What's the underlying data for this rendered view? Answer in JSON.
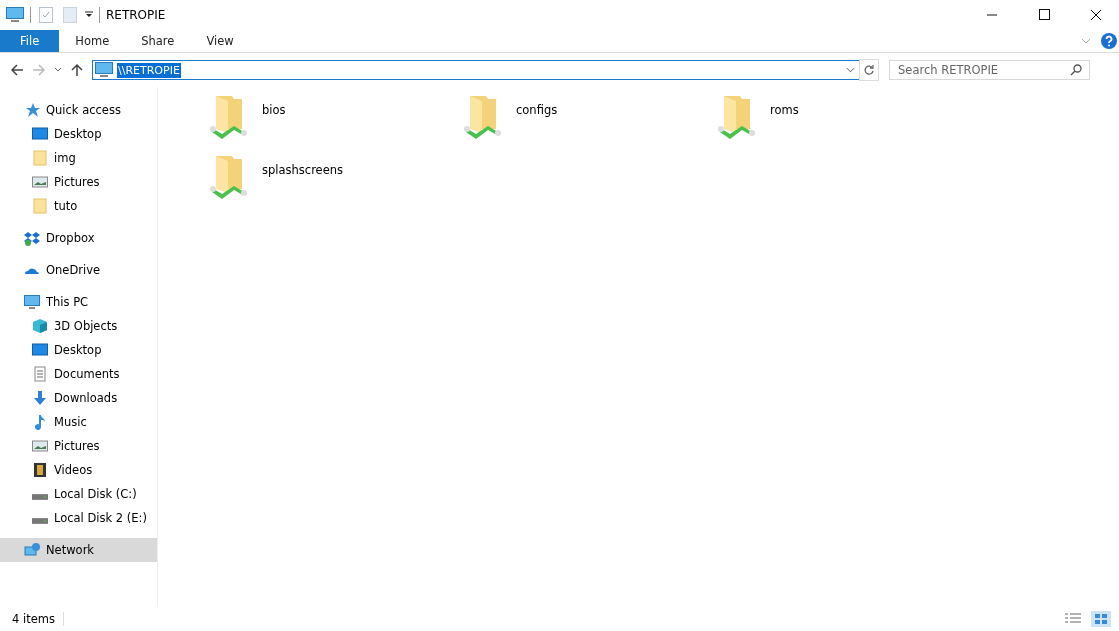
{
  "window": {
    "title": "RETROPIE"
  },
  "ribbon": {
    "tabs": [
      {
        "label": "File",
        "selected": true
      },
      {
        "label": "Home",
        "selected": false
      },
      {
        "label": "Share",
        "selected": false
      },
      {
        "label": "View",
        "selected": false
      }
    ]
  },
  "address": {
    "value": "\\\\RETROPIE"
  },
  "search": {
    "placeholder": "Search RETROPIE"
  },
  "sidebar": {
    "items": [
      {
        "label": "Quick access",
        "kind": "star",
        "selected": false,
        "children": [
          {
            "label": "Desktop",
            "kind": "desktop",
            "selected": false
          },
          {
            "label": "img",
            "kind": "folder",
            "selected": false
          },
          {
            "label": "Pictures",
            "kind": "pictures",
            "selected": false
          },
          {
            "label": "tuto",
            "kind": "folder",
            "selected": false
          }
        ]
      },
      {
        "label": "Dropbox",
        "kind": "dropbox",
        "selected": false
      },
      {
        "label": "OneDrive",
        "kind": "cloud",
        "selected": false
      },
      {
        "label": "This PC",
        "kind": "pc",
        "selected": false,
        "children": [
          {
            "label": "3D Objects",
            "kind": "cube",
            "selected": false
          },
          {
            "label": "Desktop",
            "kind": "desktop",
            "selected": false
          },
          {
            "label": "Documents",
            "kind": "document",
            "selected": false
          },
          {
            "label": "Downloads",
            "kind": "download",
            "selected": false
          },
          {
            "label": "Music",
            "kind": "music",
            "selected": false
          },
          {
            "label": "Pictures",
            "kind": "pictures",
            "selected": false
          },
          {
            "label": "Videos",
            "kind": "video",
            "selected": false
          },
          {
            "label": "Local Disk (C:)",
            "kind": "disk",
            "selected": false
          },
          {
            "label": "Local Disk 2 (E:)",
            "kind": "disk",
            "selected": false
          }
        ]
      },
      {
        "label": "Network",
        "kind": "network",
        "selected": true
      }
    ]
  },
  "folders": [
    {
      "name": "bios"
    },
    {
      "name": "configs"
    },
    {
      "name": "roms"
    },
    {
      "name": "splashscreens"
    }
  ],
  "status_bar": {
    "count": "4 items"
  }
}
